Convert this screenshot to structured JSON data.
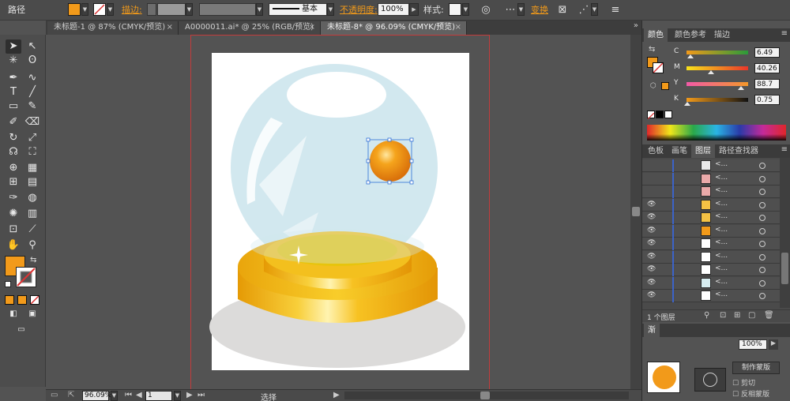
{
  "controlbar": {
    "object_type": "路径",
    "stroke_label": "描边:",
    "stroke_style": "基本",
    "opacity_label": "不透明度:",
    "opacity_value": "100%",
    "style_label": "样式:",
    "transform_label": "变换",
    "fill_color": "#f29a1a"
  },
  "tabs": [
    {
      "label": "未标题-1 @ 87% (CMYK/预览)",
      "active": false
    },
    {
      "label": "A0000011.ai* @ 25% (RGB/预览)",
      "active": false
    },
    {
      "label": "未标题-8* @ 96.09% (CMYK/预览)",
      "active": true
    }
  ],
  "statusbar": {
    "zoom": "96.09%",
    "artboard": "1",
    "tool": "选择"
  },
  "color_panel": {
    "tabs": [
      "颜色",
      "颜色参考",
      "描边"
    ],
    "channels": [
      {
        "label": "C",
        "value": "6.49",
        "fraction": 0.065
      },
      {
        "label": "M",
        "value": "40.26",
        "fraction": 0.4
      },
      {
        "label": "Y",
        "value": "88.7",
        "fraction": 0.887
      },
      {
        "label": "K",
        "value": "0.75",
        "fraction": 0.008
      }
    ]
  },
  "layers_panel": {
    "tabs": [
      "色板",
      "画笔",
      "图层",
      "路径查找器"
    ],
    "layer_count": "1 个图层",
    "row_name": "<...",
    "rows": [
      {
        "thumb": "#e8e8e8",
        "visible": false
      },
      {
        "thumb": "#e9a9a9",
        "visible": false
      },
      {
        "thumb": "#e9a9a9",
        "visible": false
      },
      {
        "thumb": "#f5c244",
        "visible": true
      },
      {
        "thumb": "#f5c244",
        "visible": true
      },
      {
        "thumb": "#f29a1a",
        "visible": true
      },
      {
        "thumb": "#ffffff",
        "visible": true
      },
      {
        "thumb": "#ffffff",
        "visible": true
      },
      {
        "thumb": "#ffffff",
        "visible": true
      },
      {
        "thumb": "#d6ecef",
        "visible": true
      },
      {
        "thumb": "#ffffff",
        "visible": true
      }
    ]
  },
  "transparency_panel": {
    "tab": "渐",
    "opacity": "100%",
    "make_mask": "制作蒙版",
    "clip": "剪切",
    "invert_mask": "反相蒙版"
  },
  "colors": {
    "accent": "#f29a1a",
    "globe": "#cfe6ee",
    "gold": "#f2b10f",
    "shadow": "#dcdcdc"
  }
}
